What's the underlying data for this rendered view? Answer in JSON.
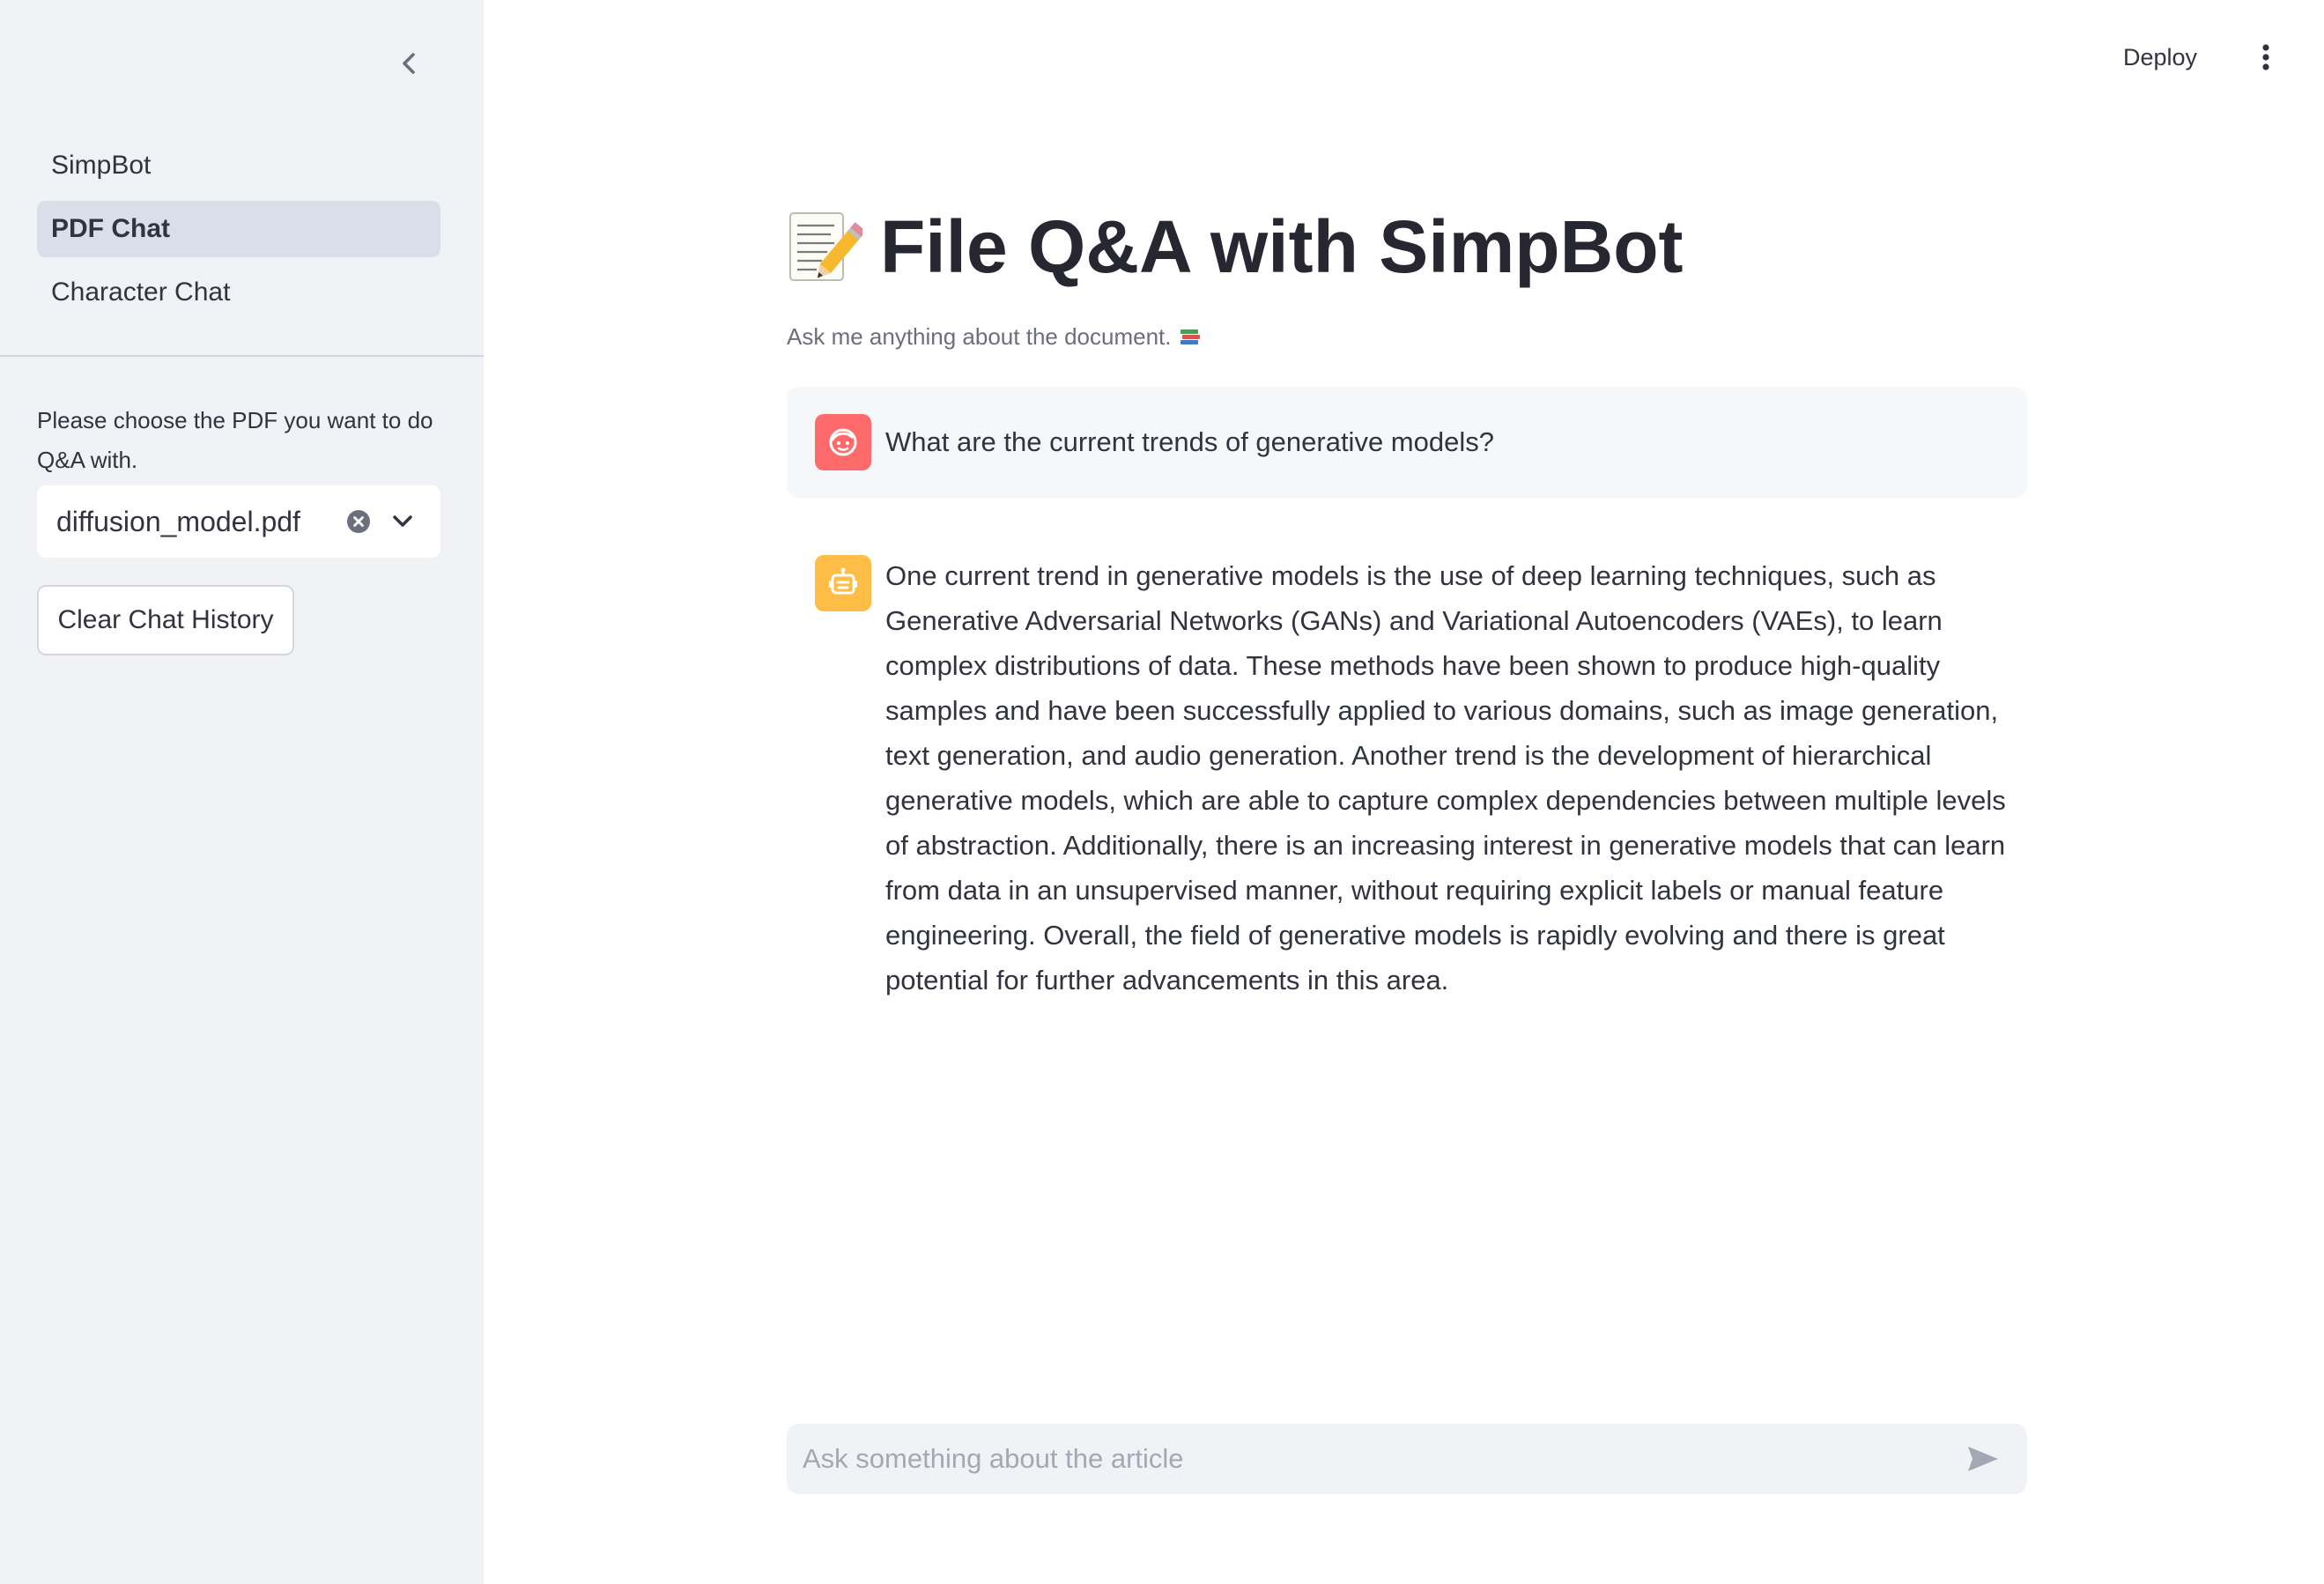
{
  "sidebar": {
    "nav": [
      {
        "label": "SimpBot",
        "active": false
      },
      {
        "label": "PDF Chat",
        "active": true
      },
      {
        "label": "Character Chat",
        "active": false
      }
    ],
    "pdf_prompt": "Please choose the PDF you want to do Q&A with.",
    "selected_pdf": "diffusion_model.pdf",
    "clear_button": "Clear Chat History"
  },
  "header": {
    "deploy": "Deploy"
  },
  "main": {
    "title": "File Q&A with SimpBot",
    "subtitle": "Ask me anything about the document.",
    "messages": [
      {
        "role": "user",
        "text": "What are the current trends of generative models?"
      },
      {
        "role": "assistant",
        "text": "One current trend in generative models is the use of deep learning techniques, such as Generative Adversarial Networks (GANs) and Variational Autoencoders (VAEs), to learn complex distributions of data. These methods have been shown to produce high-quality samples and have been successfully applied to various domains, such as image generation, text generation, and audio generation. Another trend is the development of hierarchical generative models, which are able to capture complex dependencies between multiple levels of abstraction. Additionally, there is an increasing interest in generative models that can learn from data in an unsupervised manner, without requiring explicit labels or manual feature engineering. Overall, the field of generative models is rapidly evolving and there is great potential for further advancements in this area."
      }
    ],
    "chat_input": {
      "placeholder": "Ask something about the article",
      "value": ""
    }
  },
  "colors": {
    "sidebar_bg": "#f0f2f6",
    "user_avatar": "#ff6b6b",
    "bot_avatar": "#ffbd45",
    "active_nav": "#dadee8"
  },
  "icons": {
    "title": "memo-pencil-icon",
    "subtitle": "books-icon",
    "user_avatar": "user-face-icon",
    "bot_avatar": "robot-icon"
  }
}
